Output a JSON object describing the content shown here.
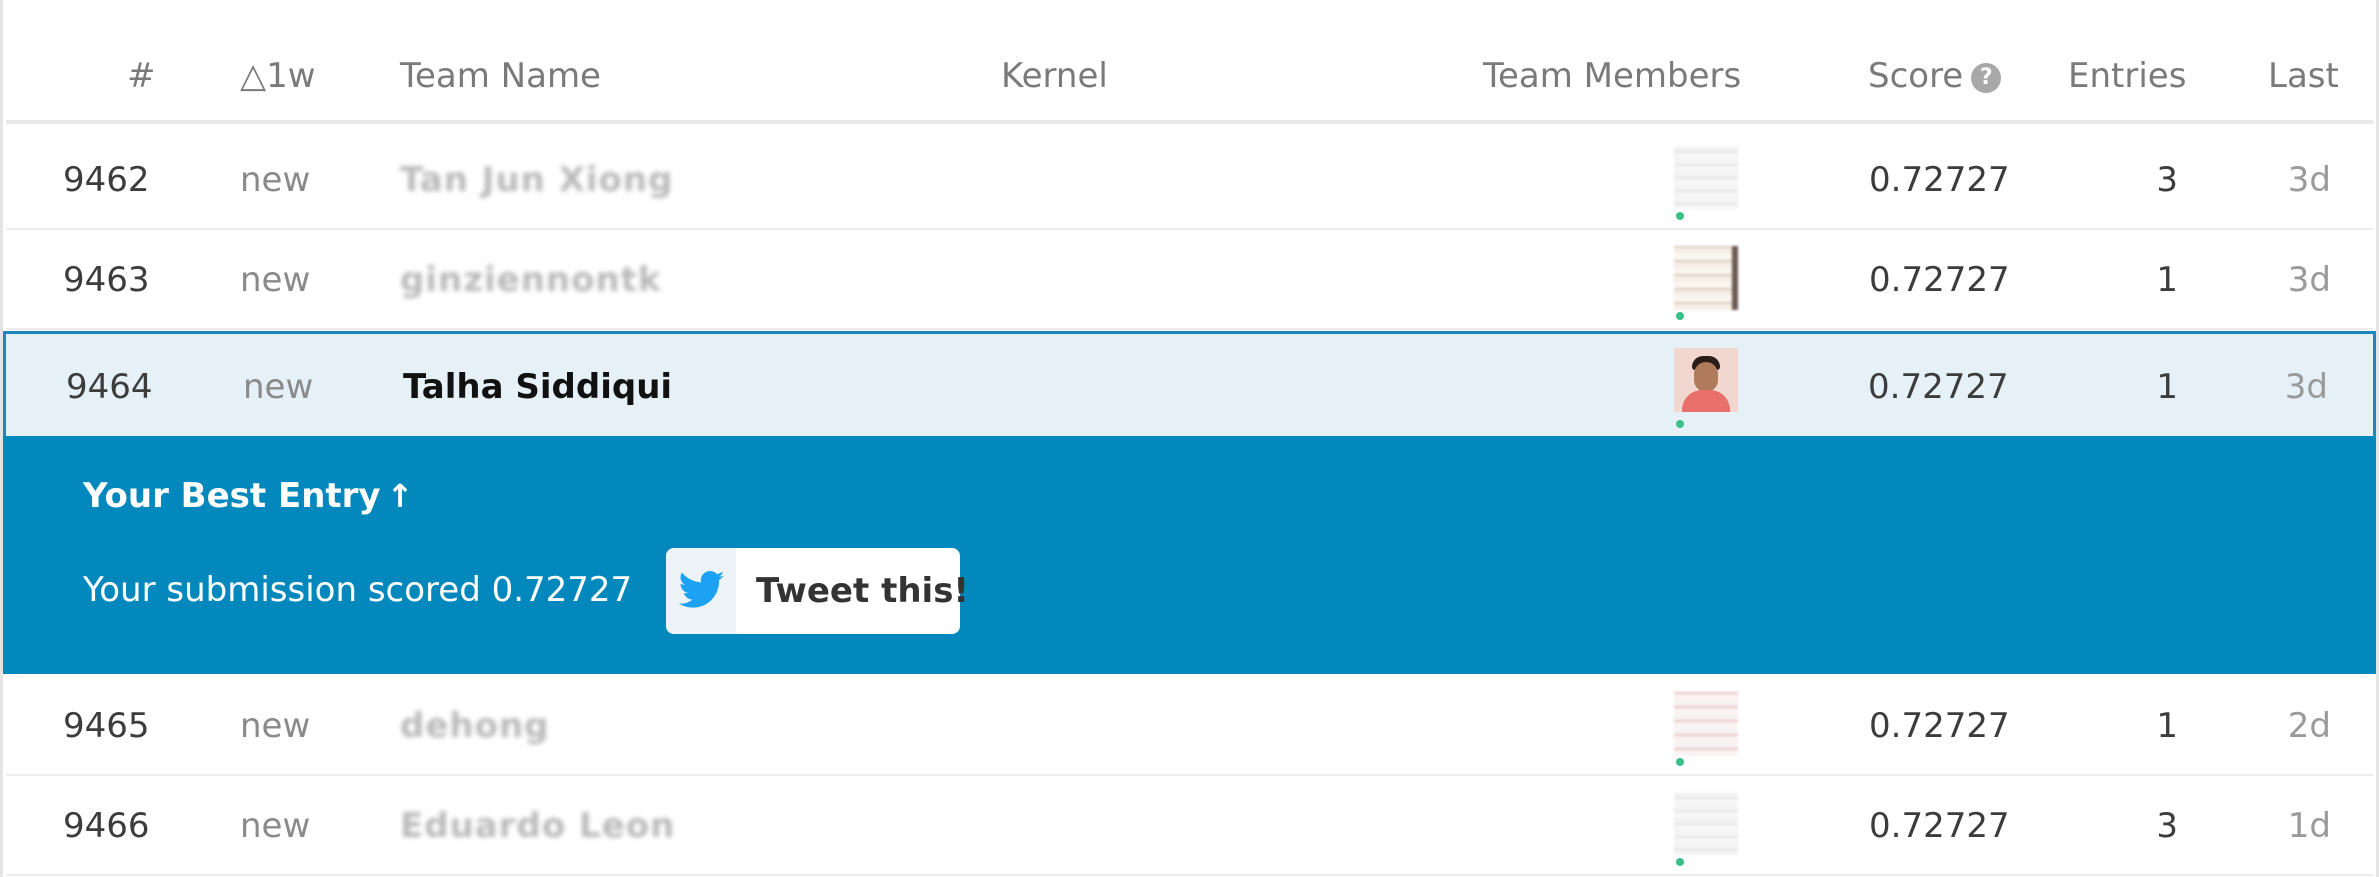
{
  "header": {
    "rank": "#",
    "change": "△1w",
    "team_name": "Team Name",
    "kernel": "Kernel",
    "team_members": "Team Members",
    "score": "Score",
    "entries": "Entries",
    "last": "Last"
  },
  "rows_before": [
    {
      "rank": "9462",
      "change": "new",
      "team": "Tan Jun Xiong",
      "score": "0.72727",
      "entries": "3",
      "last": "3d"
    },
    {
      "rank": "9463",
      "change": "new",
      "team": "ginziennontk",
      "score": "0.72727",
      "entries": "1",
      "last": "3d"
    }
  ],
  "me_row": {
    "rank": "9464",
    "change": "new",
    "team": "Talha Siddiqui",
    "score": "0.72727",
    "entries": "1",
    "last": "3d"
  },
  "best_entry": {
    "title": "Your Best Entry",
    "arrow_glyph": "↑",
    "text": "Your submission scored 0.72727",
    "tweet_label": "Tweet this!"
  },
  "rows_after": [
    {
      "rank": "9465",
      "change": "new",
      "team": "dehong",
      "score": "0.72727",
      "entries": "1",
      "last": "2d"
    },
    {
      "rank": "9466",
      "change": "new",
      "team": "Eduardo Leon",
      "score": "0.72727",
      "entries": "3",
      "last": "1d"
    }
  ],
  "help_glyph": "?",
  "colors": {
    "accent": "#0288bd",
    "highlight_row": "#e6f1f7",
    "online": "#3bbf8a"
  }
}
